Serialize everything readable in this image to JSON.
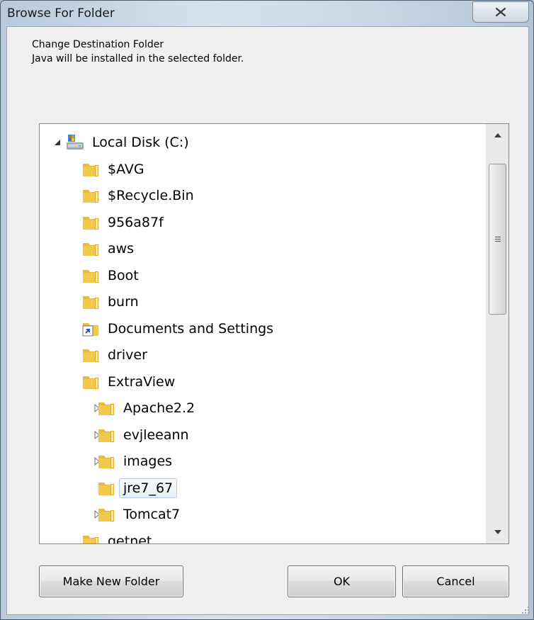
{
  "window": {
    "title": "Browse For Folder"
  },
  "description": {
    "line1": "Change Destination Folder",
    "line2": "Java will be installed in the selected folder."
  },
  "tree": {
    "items": [
      {
        "label": "Local Disk (C:)",
        "level": 0,
        "expander": "expanded",
        "icon": "drive-icon"
      },
      {
        "label": "$AVG",
        "level": 1,
        "expander": "collapsed",
        "icon": "folder-icon"
      },
      {
        "label": "$Recycle.Bin",
        "level": 1,
        "expander": "collapsed",
        "icon": "folder-icon"
      },
      {
        "label": "956a87f",
        "level": 1,
        "expander": "none",
        "icon": "folder-icon"
      },
      {
        "label": "aws",
        "level": 1,
        "expander": "collapsed",
        "icon": "folder-icon"
      },
      {
        "label": "Boot",
        "level": 1,
        "expander": "collapsed",
        "icon": "folder-icon"
      },
      {
        "label": "burn",
        "level": 1,
        "expander": "collapsed",
        "icon": "folder-icon"
      },
      {
        "label": "Documents and Settings",
        "level": 1,
        "expander": "collapsed",
        "icon": "shortcut-icon"
      },
      {
        "label": "driver",
        "level": 1,
        "expander": "none",
        "icon": "folder-icon"
      },
      {
        "label": "ExtraView",
        "level": 1,
        "expander": "expanded",
        "icon": "folder-icon"
      },
      {
        "label": "Apache2.2",
        "level": 2,
        "expander": "collapsed",
        "icon": "folder-icon"
      },
      {
        "label": "evjleeann",
        "level": 2,
        "expander": "collapsed",
        "icon": "folder-icon"
      },
      {
        "label": "images",
        "level": 2,
        "expander": "collapsed",
        "icon": "folder-icon"
      },
      {
        "label": "jre7_67",
        "level": 2,
        "expander": "none",
        "icon": "folder-icon",
        "selected": true
      },
      {
        "label": "Tomcat7",
        "level": 2,
        "expander": "collapsed",
        "icon": "folder-icon"
      },
      {
        "label": "getnet",
        "level": 1,
        "expander": "none",
        "icon": "folder-icon"
      }
    ]
  },
  "buttons": {
    "make_new_folder": "Make New Folder",
    "ok": "OK",
    "cancel": "Cancel"
  },
  "colors": {
    "folder": "#f2c94c",
    "selection": "#e6eef7"
  }
}
